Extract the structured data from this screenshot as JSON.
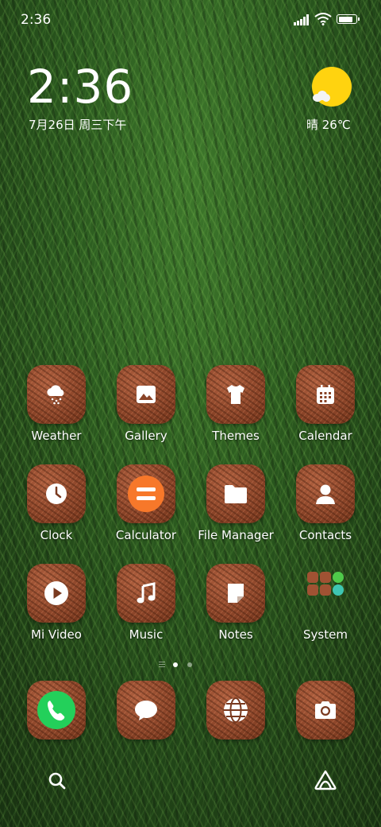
{
  "status_bar": {
    "time": "2:36",
    "battery_level": 0.85
  },
  "clock_widget": {
    "time": "2:36",
    "date": "7月26日 周三下午"
  },
  "weather_widget": {
    "condition_temp": "晴 26℃",
    "icon": "sun-cloud-icon",
    "sun_color": "#ffd30f"
  },
  "apps": [
    {
      "label": "Weather",
      "icon": "cloud-rain-icon"
    },
    {
      "label": "Gallery",
      "icon": "image-icon"
    },
    {
      "label": "Themes",
      "icon": "tshirt-icon"
    },
    {
      "label": "Calendar",
      "icon": "calendar-icon"
    },
    {
      "label": "Clock",
      "icon": "clock-icon"
    },
    {
      "label": "Calculator",
      "icon": "calculator-icon",
      "accent": "#f7782a"
    },
    {
      "label": "File Manager",
      "icon": "folder-icon"
    },
    {
      "label": "Contacts",
      "icon": "person-icon"
    },
    {
      "label": "Mi Video",
      "icon": "play-icon"
    },
    {
      "label": "Music",
      "icon": "music-note-icon"
    },
    {
      "label": "Notes",
      "icon": "note-icon"
    },
    {
      "label": "System",
      "icon": "folder-grid-icon"
    }
  ],
  "page_indicator": {
    "pages": 2,
    "current": 1
  },
  "dock": [
    {
      "name": "phone",
      "icon": "phone-icon",
      "accent": "#23d05a"
    },
    {
      "name": "messages",
      "icon": "chat-bubble-icon"
    },
    {
      "name": "browser",
      "icon": "globe-icon"
    },
    {
      "name": "camera",
      "icon": "camera-icon"
    }
  ],
  "nav": {
    "left": "search-icon",
    "right": "assistant-icon"
  }
}
